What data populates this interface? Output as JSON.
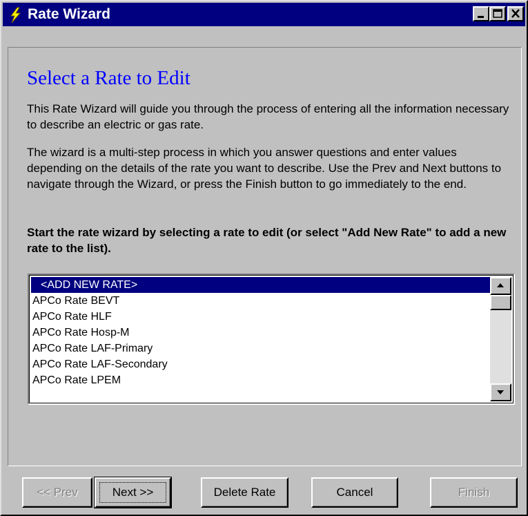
{
  "window": {
    "title": "Rate Wizard",
    "app_icon": "lightning-icon",
    "controls": [
      "minimize-icon",
      "maximize-icon",
      "close-icon"
    ]
  },
  "page": {
    "heading": "Select a Rate to Edit",
    "intro": "This Rate Wizard will guide you through the process of entering all the information necessary to describe an electric or gas rate.",
    "description": "The wizard is a multi-step process in which you answer questions and enter values depending on the details of the rate you want to describe.  Use the Prev and Next buttons to navigate through the Wizard, or press the Finish button to go immediately to the end.",
    "instruction": "Start the rate wizard by selecting a rate to edit (or select \"Add New Rate\" to add a new rate to the list)."
  },
  "rate_list": {
    "selected_index": 0,
    "items": [
      "<ADD NEW RATE>",
      "APCo Rate BEVT",
      "APCo Rate HLF",
      "APCo Rate Hosp-M",
      "APCo Rate LAF-Primary",
      "APCo Rate LAF-Secondary",
      "APCo Rate LPEM"
    ]
  },
  "buttons": {
    "prev": {
      "label": "<< Prev",
      "enabled": false
    },
    "next": {
      "label": "Next >>",
      "enabled": true
    },
    "delete": {
      "label": "Delete Rate",
      "enabled": true
    },
    "cancel": {
      "label": "Cancel",
      "enabled": true
    },
    "finish": {
      "label": "Finish",
      "enabled": false
    }
  },
  "colors": {
    "titlebar": "#000080",
    "face": "#c0c0c0",
    "heading": "#0000ff",
    "selection": "#000080"
  }
}
